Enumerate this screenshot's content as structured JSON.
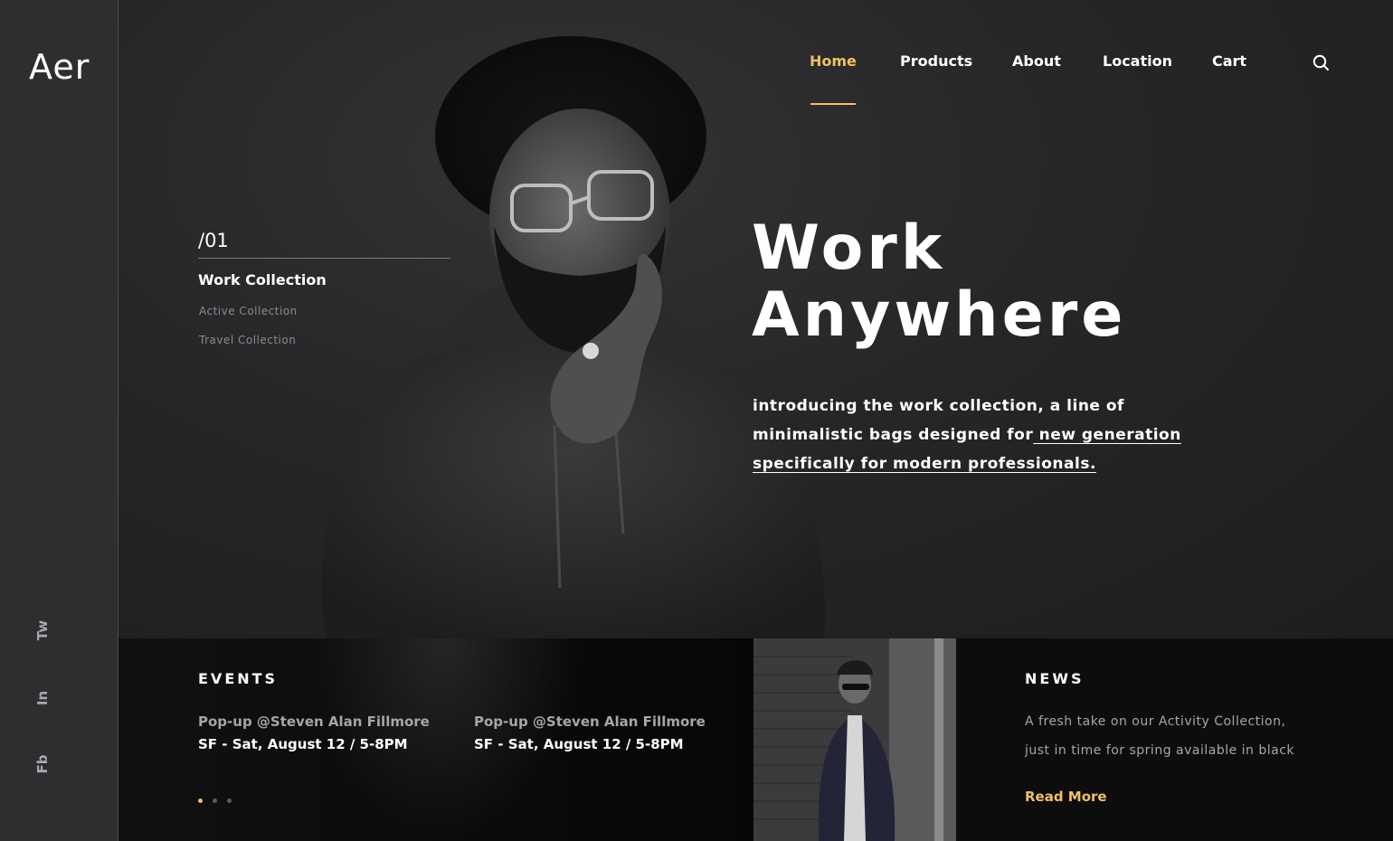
{
  "brand": {
    "logo_text": "Aer"
  },
  "social": {
    "twitter": "Tw",
    "linkedin": "In",
    "facebook": "Fb"
  },
  "nav": {
    "items": [
      {
        "label": "Home",
        "active": true
      },
      {
        "label": "Products",
        "active": false
      },
      {
        "label": "About",
        "active": false
      },
      {
        "label": "Location",
        "active": false
      },
      {
        "label": "Cart",
        "active": false
      }
    ],
    "search_icon": "search-icon"
  },
  "slider": {
    "index_label": "/01",
    "collections": [
      "Work Collection",
      "Active Collection",
      "Travel Collection"
    ],
    "dots_count": 3,
    "active_dot": 0
  },
  "hero": {
    "headline_line1": "Work",
    "headline_line2": "Anywhere",
    "intro_text": "introducing the work collection, a line of minimalistic bags designed for",
    "intro_link": " new generation specifically for modern professionals."
  },
  "events": {
    "title": "EVENTS",
    "items": [
      {
        "name": "Pop-up @Steven Alan Fillmore",
        "detail": "SF - Sat, August 12 / 5-8PM"
      },
      {
        "name": "Pop-up @Steven Alan Fillmore",
        "detail": "SF - Sat, August 12 / 5-8PM"
      }
    ]
  },
  "news": {
    "title": "NEWS",
    "text": "A fresh take on our Activity Collection, just in time for spring available in black",
    "link": "Read More"
  },
  "colors": {
    "accent": "#f2c05e",
    "background": "#232325",
    "rail": "#2e2e30",
    "band": "#0d0d0e"
  }
}
